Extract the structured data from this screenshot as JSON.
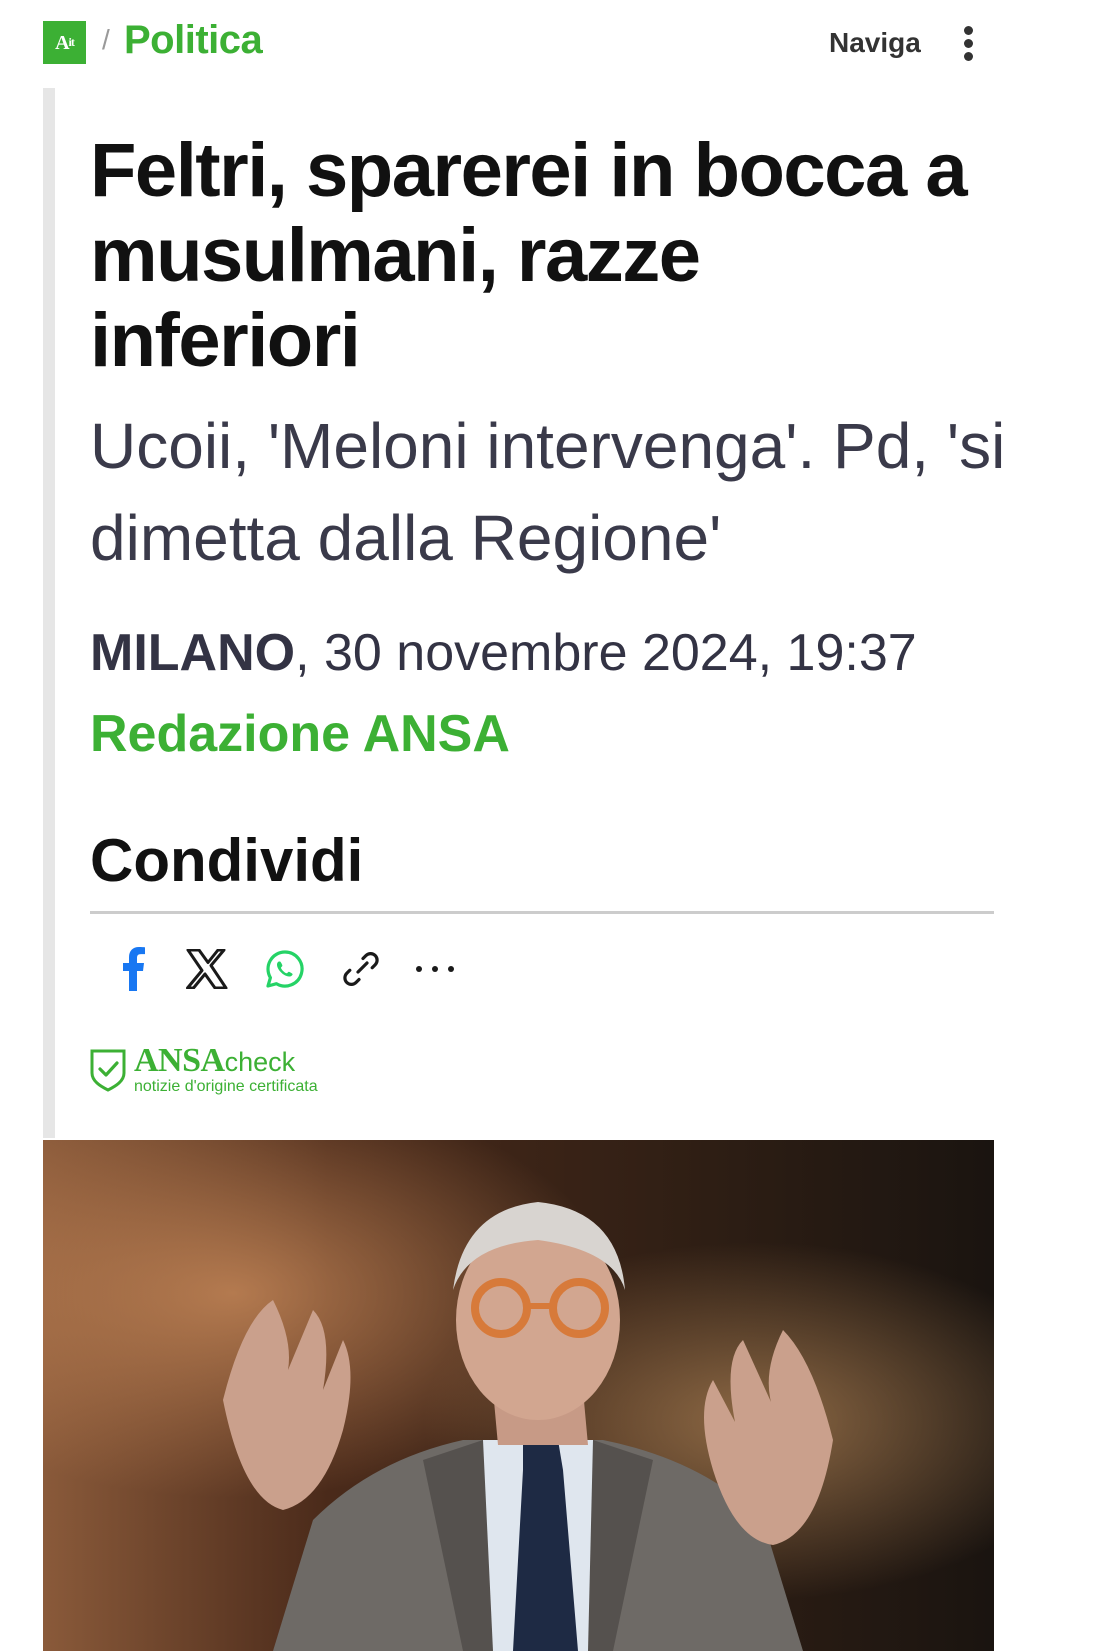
{
  "header": {
    "logo_text": "A",
    "logo_suffix": "it",
    "breadcrumb_separator": "/",
    "section": "Politica",
    "nav_label": "Naviga"
  },
  "article": {
    "headline": "Feltri, sparerei in bocca a musulmani, razze inferiori",
    "subtitle": "Ucoii, 'Meloni intervenga'. Pd, 'si dimetta dalla Regione'",
    "location": "MILANO",
    "date_rest": ", 30 novembre 2024, 19:37",
    "author": "Redazione ANSA"
  },
  "share": {
    "title": "Condividi",
    "buttons": [
      {
        "name": "facebook",
        "icon": "facebook-icon"
      },
      {
        "name": "x",
        "icon": "x-icon"
      },
      {
        "name": "whatsapp",
        "icon": "whatsapp-icon"
      },
      {
        "name": "link",
        "icon": "link-icon"
      },
      {
        "name": "more",
        "icon": "more-icon"
      }
    ]
  },
  "ansacheck": {
    "brand_bold": "ANSA",
    "brand_light": "check",
    "tagline": "notizie d'origine certificata"
  },
  "colors": {
    "brand_green": "#3cb034",
    "facebook_blue": "#1877f2",
    "whatsapp_green": "#25d366",
    "text_dark": "#111111"
  }
}
